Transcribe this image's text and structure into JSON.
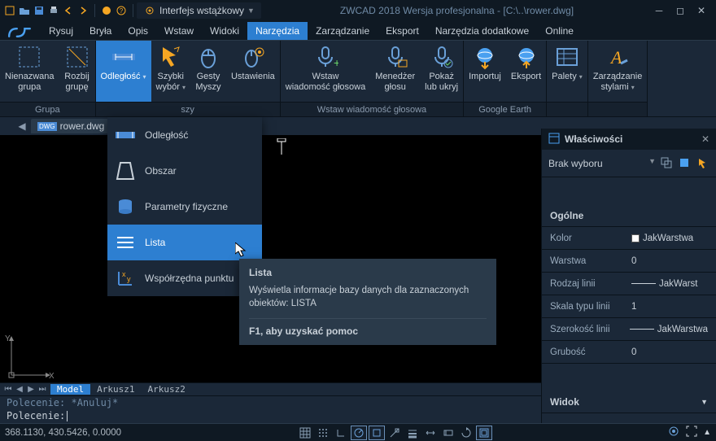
{
  "titlebar": {
    "workspace_label": "Interfejs wstążkowy",
    "title": "ZWCAD 2018 Wersja profesjonalna - [C:\\..\\rower.dwg]"
  },
  "menubar": {
    "items": [
      "Rysuj",
      "Bryła",
      "Opis",
      "Wstaw",
      "Widoki",
      "Narzędzia",
      "Zarządzanie",
      "Eksport",
      "Narzędzia dodatkowe",
      "Online"
    ],
    "active_index": 5
  },
  "ribbon": {
    "groups": [
      {
        "label": "Grupa",
        "items": [
          {
            "label": "Nienazwana grupa",
            "icon": "group-dashed"
          },
          {
            "label": "Rozbij grupę",
            "icon": "group-break"
          }
        ]
      },
      {
        "label": "szy",
        "items": [
          {
            "label": "Odległość",
            "icon": "distance",
            "active": true,
            "dropdown": true
          },
          {
            "label": "Szybki wybór",
            "icon": "quick-select",
            "dropdown": true
          },
          {
            "label": "Gesty Myszy",
            "icon": "mouse-gestures"
          },
          {
            "label": "Ustawienia",
            "icon": "mouse-settings"
          }
        ]
      },
      {
        "label": "Wstaw wiadomość głosowa",
        "items": [
          {
            "label": "Wstaw wiadomość głosowa",
            "icon": "mic-insert"
          },
          {
            "label": "Menedżer głosu",
            "icon": "mic-manager"
          },
          {
            "label": "Pokaż lub ukryj",
            "icon": "mic-toggle"
          }
        ]
      },
      {
        "label": "Google Earth",
        "items": [
          {
            "label": "Importuj",
            "icon": "earth-import"
          },
          {
            "label": "Eksport",
            "icon": "earth-export"
          }
        ]
      },
      {
        "label": "",
        "items": [
          {
            "label": "Palety",
            "icon": "palettes",
            "dropdown": true
          }
        ]
      },
      {
        "label": "",
        "items": [
          {
            "label": "Zarządzanie stylami",
            "icon": "styles",
            "dropdown": true
          }
        ]
      }
    ]
  },
  "filetabs": {
    "files": [
      {
        "name": "rower.dwg"
      }
    ]
  },
  "dropdown": {
    "items": [
      "Odległość",
      "Obszar",
      "Parametry fizyczne",
      "Lista",
      "Współrzędna punktu"
    ],
    "selected_index": 3
  },
  "tooltip": {
    "title": "Lista",
    "body": "Wyświetla informacje bazy danych dla zaznaczonych obiektów:  LISTA",
    "help": "F1, aby uzyskać pomoc"
  },
  "properties": {
    "title": "Właściwości",
    "selection": "Brak wyboru",
    "section_general": "Ogólne",
    "rows": [
      {
        "k": "Kolor",
        "v": "JakWarstwa",
        "swatch": true
      },
      {
        "k": "Warstwa",
        "v": "0"
      },
      {
        "k": "Rodzaj linii",
        "v": "JakWarst",
        "line": true
      },
      {
        "k": "Skala typu linii",
        "v": "1"
      },
      {
        "k": "Szerokość linii",
        "v": "JakWarstwa",
        "line": true
      },
      {
        "k": "Grubość",
        "v": "0"
      }
    ],
    "section_view": "Widok"
  },
  "layouttabs": {
    "tabs": [
      "Model",
      "Arkusz1",
      "Arkusz2"
    ],
    "active_index": 0
  },
  "cmdline": {
    "history": "Polecenie: *Anuluj*",
    "prompt": "Polecenie: "
  },
  "statusbar": {
    "coords": "368.1130, 430.5426, 0.0000"
  },
  "axes": {
    "x": "X",
    "y": "Y"
  }
}
